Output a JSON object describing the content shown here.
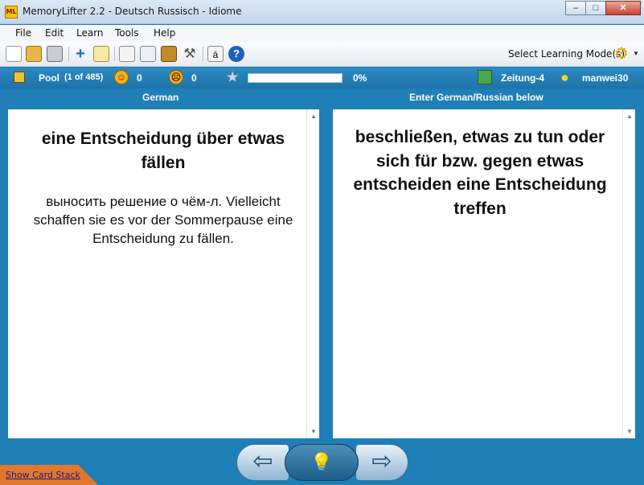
{
  "window": {
    "title": "MemoryLifter 2.2 - Deutsch Russisch - Idiome",
    "app_icon_text": "ML",
    "controls": {
      "minimize": "–",
      "maximize": "□",
      "close": "✕"
    }
  },
  "menu": [
    "File",
    "Edit",
    "Learn",
    "Tools",
    "Help"
  ],
  "toolbar": {
    "icons": [
      "new-file-icon",
      "open-folder-icon",
      "print-icon",
      "add-card-icon",
      "edit-card-icon",
      "presentation-icon",
      "card-style-icon",
      "box-icon",
      "tools-icon",
      "special-char-icon",
      "help-icon"
    ],
    "special_char": "á",
    "help_char": "?",
    "mode_label": "Select Learning Mode(s)"
  },
  "status": {
    "pool_label": "Pool",
    "pool_count": "(1 of 485)",
    "correct_count": "0",
    "wrong_count": "0",
    "progress_percent": 0,
    "progress_text": "0%",
    "chapter": "Zeitung-4",
    "user": "manwei30"
  },
  "columns": {
    "left_header": "German",
    "right_header": "Enter German/Russian below"
  },
  "question": {
    "title": "eine Entscheidung über etwas fällen",
    "example": "выносить решение о чём-л. Vielleicht schaffen sie es vor der Sommerpause eine Entscheidung zu fällen."
  },
  "answer": {
    "text": "beschließen, etwas zu tun oder sich für bzw. gegen etwas entscheiden eine Entscheidung treffen"
  },
  "nav": {
    "prev_glyph": "⇦",
    "hint_glyph": "💡",
    "next_glyph": "⇨"
  },
  "footer": {
    "card_stack_link": "Show Card Stack"
  }
}
